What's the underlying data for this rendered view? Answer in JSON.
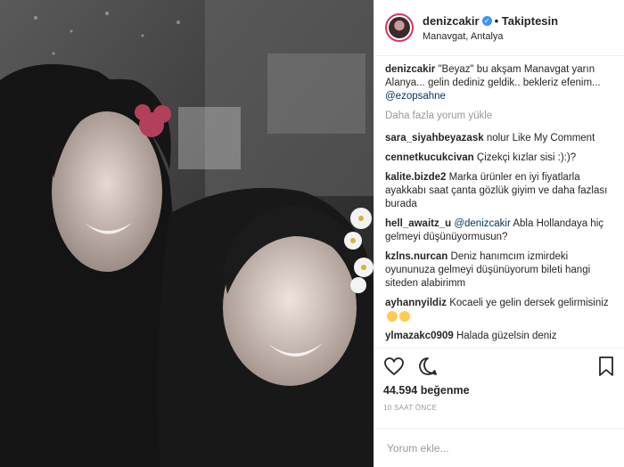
{
  "post": {
    "username": "denizcakir",
    "follow_status": "• Takiptesin",
    "location": "Manavgat, Antalya",
    "caption": {
      "user": "denizcakir",
      "text": "\"Beyaz\" bu akşam Manavgat yarın Alanya... gelin dediniz geldik.. bekleriz efenim...",
      "mention": "@ezopsahne"
    },
    "load_more": "Daha fazla yorum yükle",
    "comments": [
      {
        "user": "sara_siyahbeyazask",
        "text": "nolur Like My Comment"
      },
      {
        "user": "cennetkucukcivan",
        "text": "Çizekçi kızlar sisi :):)?"
      },
      {
        "user": "kalite.bizde2",
        "text": "Marka ürünler en iyi fiyatlarla ayakkabı saat çanta gözlük giyim ve daha fazlası burada"
      },
      {
        "user": "hell_awaitz_u",
        "mention": "@denizcakir",
        "text": "Abla Hollandaya hiç gelmeyi düşünüyormusun?"
      },
      {
        "user": "kzlns.nurcan",
        "text": "Deniz hanımcım izmirdeki oyununuza gelmeyi düşünüyorum bileti hangi siteden alabirimm"
      },
      {
        "user": "ayhannyildiz",
        "text": "Kocaeli ye gelin dersek gelirmisiniz"
      },
      {
        "user": "ylmazakc0909",
        "text": "Halada güzelsin deniz"
      }
    ],
    "likes": "44.594 beğenme",
    "time": "10 SAAT ÖNCE",
    "comment_placeholder": "Yorum ekle...",
    "icons": {
      "like": "heart-icon",
      "comment": "comment-icon",
      "save": "bookmark-icon",
      "verified": "verified-badge-icon"
    },
    "colors": {
      "link": "#003569",
      "verified": "#3897f0",
      "muted": "#999999"
    }
  }
}
